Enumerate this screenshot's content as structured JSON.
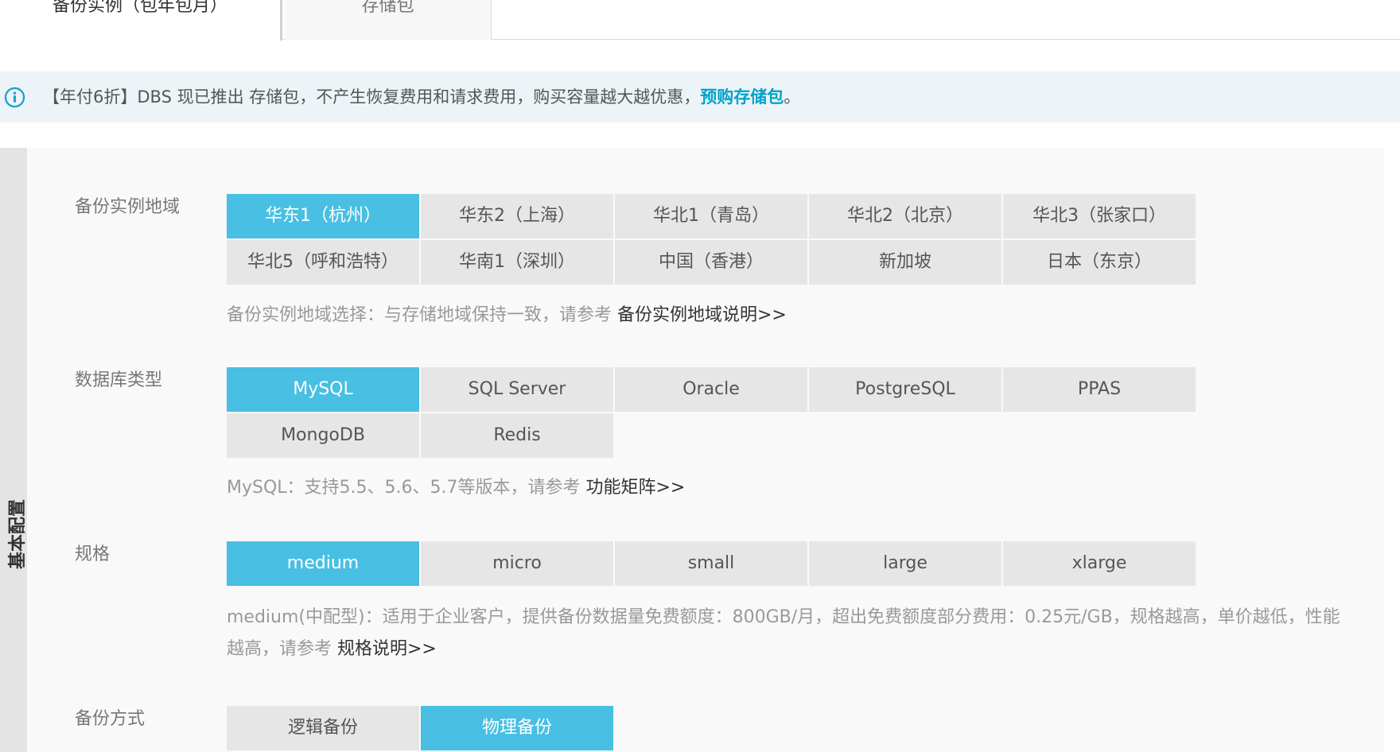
{
  "tabs": [
    {
      "label": "备份实例（包年包月）"
    },
    {
      "label": "存储包"
    }
  ],
  "notice": {
    "text": "【年付6折】DBS 现已推出 存储包，不产生恢复费用和请求费用，购买容量越大越优惠，",
    "link": "预购存储包",
    "suffix": "。"
  },
  "panel": {
    "section_label": "基本配置"
  },
  "region": {
    "label": "备份实例地域",
    "options": [
      "华东1（杭州）",
      "华东2（上海）",
      "华北1（青岛）",
      "华北2（北京）",
      "华北3（张家口）",
      "华北5（呼和浩特）",
      "华南1（深圳）",
      "中国（香港）",
      "新加坡",
      "日本（东京）"
    ],
    "selected_index": 0,
    "hint": "备份实例地域选择：与存储地域保持一致，请参考 ",
    "hint_link": "备份实例地域说明>>"
  },
  "db_type": {
    "label": "数据库类型",
    "options": [
      "MySQL",
      "SQL Server",
      "Oracle",
      "PostgreSQL",
      "PPAS",
      "MongoDB",
      "Redis"
    ],
    "selected_index": 0,
    "hint": "MySQL：支持5.5、5.6、5.7等版本，请参考 ",
    "hint_link": "功能矩阵>>"
  },
  "spec": {
    "label": "规格",
    "options": [
      "medium",
      "micro",
      "small",
      "large",
      "xlarge"
    ],
    "selected_index": 0,
    "hint": "medium(中配型)：适用于企业客户，提供备份数据量免费额度：800GB/月，超出免费额度部分费用：0.25元/GB，规格越高，单价越低，性能越高，请参考 ",
    "hint_link": "规格说明>>"
  },
  "backup_method": {
    "label": "备份方式",
    "options": [
      "逻辑备份",
      "物理备份"
    ],
    "selected_index": 1
  },
  "colors": {
    "accent": "#48bfe3",
    "link": "#00a2ca",
    "notice_bg": "#edf4f7"
  }
}
